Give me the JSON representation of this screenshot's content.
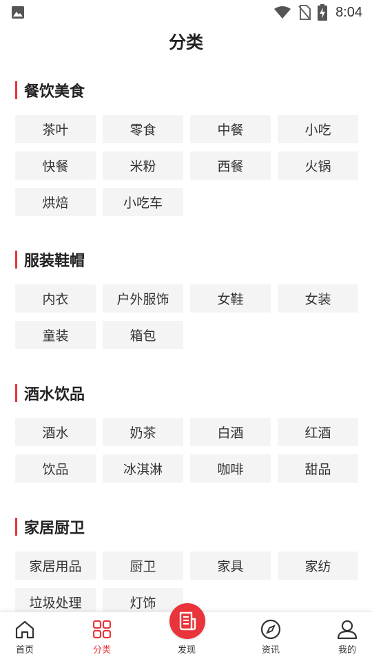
{
  "status_bar": {
    "time": "8:04",
    "icons": [
      "image-icon",
      "wifi-icon",
      "no-sim-icon",
      "battery-charging-icon"
    ]
  },
  "page": {
    "title": "分类"
  },
  "sections": [
    {
      "title": "餐饮美食",
      "tags": [
        "茶叶",
        "零食",
        "中餐",
        "小吃",
        "快餐",
        "米粉",
        "西餐",
        "火锅",
        "烘焙",
        "小吃车"
      ]
    },
    {
      "title": "服装鞋帽",
      "tags": [
        "内衣",
        "户外服饰",
        "女鞋",
        "女装",
        "童装",
        "箱包"
      ]
    },
    {
      "title": "酒水饮品",
      "tags": [
        "酒水",
        "奶茶",
        "白酒",
        "红酒",
        "饮品",
        "冰淇淋",
        "咖啡",
        "甜品"
      ]
    },
    {
      "title": "家居厨卫",
      "tags": [
        "家居用品",
        "厨卫",
        "家具",
        "家纺",
        "垃圾处理",
        "灯饰"
      ]
    }
  ],
  "bottom_nav": {
    "items": [
      {
        "label": "首页",
        "icon": "home-icon"
      },
      {
        "label": "分类",
        "icon": "grid-icon"
      },
      {
        "label": "发现",
        "icon": "document-icon"
      },
      {
        "label": "资讯",
        "icon": "compass-icon"
      },
      {
        "label": "我的",
        "icon": "user-icon"
      }
    ],
    "active_index": 1,
    "accent_color": "#e8343a"
  }
}
